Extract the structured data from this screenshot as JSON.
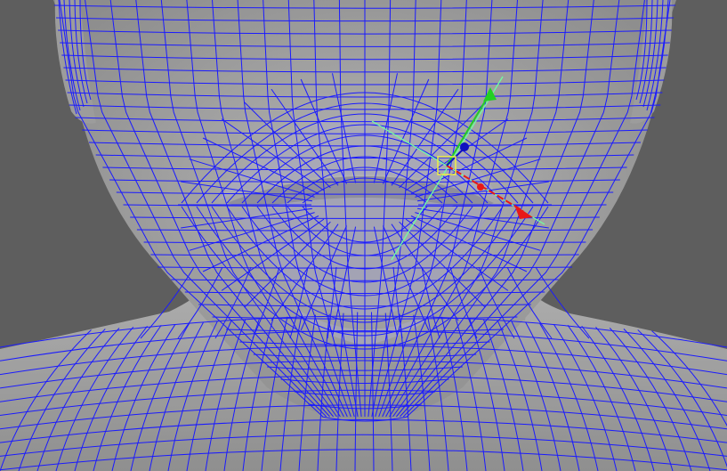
{
  "viewport": {
    "view": "perspective",
    "shading": "wireframe-on-shaded",
    "selected_component": "vertex"
  },
  "colors": {
    "background": "#5e5e5e",
    "mesh_fill": "#a6a6a6",
    "mesh_shadow": "#8a8a8a",
    "wireframe": "#1a1aff",
    "gizmo_x": "#e81818",
    "gizmo_y": "#22d022",
    "gizmo_z": "#1010c0",
    "manip_line": "#70ffa0",
    "selection_box": "#f0f040"
  },
  "gizmo": {
    "tool": "move",
    "axes": [
      "x",
      "y",
      "z"
    ]
  }
}
